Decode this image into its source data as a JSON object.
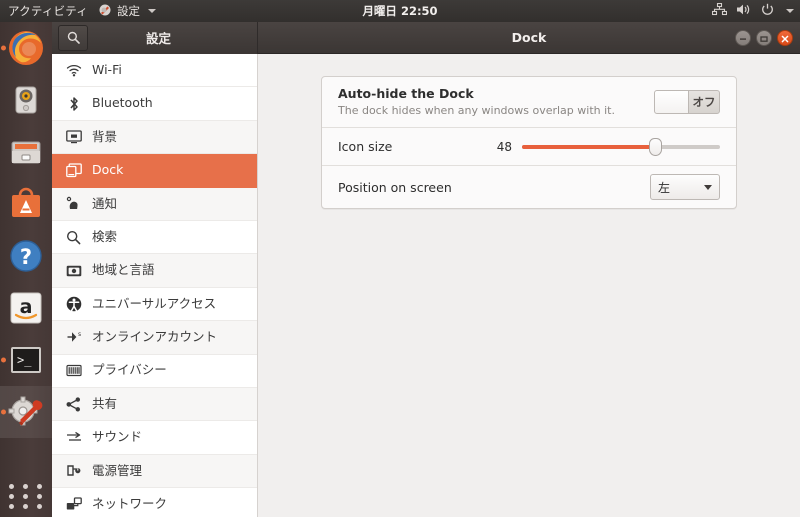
{
  "topbar": {
    "activities": "アクティビティ",
    "app_menu": {
      "name": "設定",
      "icon": "settings-app-icon",
      "arrow": "chevron-down-icon"
    },
    "clock": "月曜日 22:50",
    "tray": [
      {
        "name": "network-icon"
      },
      {
        "name": "volume-icon"
      },
      {
        "name": "power-icon"
      },
      {
        "name": "chevron-down-icon"
      }
    ]
  },
  "launcher": {
    "items": [
      {
        "name": "firefox",
        "icon": "firefox-icon",
        "running": true,
        "active": false
      },
      {
        "name": "rhythmbox",
        "icon": "rhythmbox-icon",
        "running": false,
        "active": false
      },
      {
        "name": "files",
        "icon": "files-icon",
        "running": false,
        "active": false
      },
      {
        "name": "ubuntu-software",
        "icon": "ubuntu-software-icon",
        "running": false,
        "active": false
      },
      {
        "name": "help",
        "icon": "help-icon",
        "running": false,
        "active": false
      },
      {
        "name": "amazon",
        "icon": "amazon-icon",
        "running": false,
        "active": false
      },
      {
        "name": "terminal",
        "icon": "terminal-icon",
        "running": true,
        "active": false
      },
      {
        "name": "settings",
        "icon": "settings-icon",
        "running": true,
        "active": true
      }
    ],
    "show_applications": "app-grid-icon"
  },
  "window": {
    "sidebar_title": "設定",
    "search_icon": "search-icon",
    "title": "Dock",
    "buttons": {
      "minimize": "minimize-button",
      "maximize": "maximize-button",
      "close": "close-button"
    }
  },
  "sidebar": {
    "items": [
      {
        "label": "Wi-Fi",
        "icon": "wifi-icon"
      },
      {
        "label": "Bluetooth",
        "icon": "bluetooth-icon"
      },
      {
        "label": "背景",
        "icon": "background-icon"
      },
      {
        "label": "Dock",
        "icon": "dock-icon"
      },
      {
        "label": "通知",
        "icon": "notifications-icon"
      },
      {
        "label": "検索",
        "icon": "search-icon"
      },
      {
        "label": "地域と言語",
        "icon": "region-language-icon"
      },
      {
        "label": "ユニバーサルアクセス",
        "icon": "universal-access-icon"
      },
      {
        "label": "オンラインアカウント",
        "icon": "online-accounts-icon"
      },
      {
        "label": "プライバシー",
        "icon": "privacy-icon"
      },
      {
        "label": "共有",
        "icon": "sharing-icon"
      },
      {
        "label": "サウンド",
        "icon": "sound-icon"
      },
      {
        "label": "電源管理",
        "icon": "power-icon"
      },
      {
        "label": "ネットワーク",
        "icon": "network-icon"
      }
    ],
    "selected_index": 3
  },
  "panel": {
    "autohide": {
      "title": "Auto-hide the Dock",
      "subtitle": "The dock hides when any windows overlap with it.",
      "toggle_state": "オフ",
      "toggle_on": false
    },
    "icon_size": {
      "label": "Icon size",
      "value": "48",
      "fill_percent": 67
    },
    "position": {
      "label": "Position on screen",
      "value": "左"
    }
  },
  "colors": {
    "accent": "#E7704A",
    "slider": "#E8603C",
    "close_button": "#E95420",
    "topbar": "#3b3634"
  }
}
